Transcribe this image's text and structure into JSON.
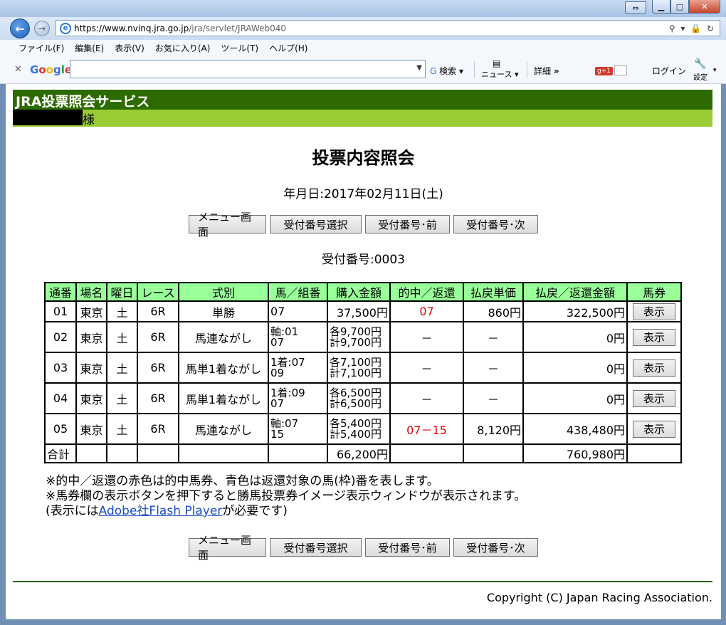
{
  "browser": {
    "url_host": "https://www.nvinq.jra.go.jp",
    "url_path": "/jra/servlet/JRAWeb040",
    "address_tools": "⚲ ▾ 🔒 ↻",
    "menu": [
      "ファイル(F)",
      "編集(E)",
      "表示(V)",
      "お気に入り(A)",
      "ツール(T)",
      "ヘルプ(H)"
    ],
    "google_toolbar": {
      "logo": "Google",
      "search_label": "検索",
      "news_label": "ニュース",
      "detail_label": "詳細",
      "gplus_label": "g+1",
      "login_label": "ログイン",
      "settings_label": "設定"
    }
  },
  "page": {
    "service_title": "JRA投票照会サービス",
    "user_suffix": "様",
    "heading": "投票内容照会",
    "date_label": "年月日:2017年02月11日(土)",
    "receipt_label": "受付番号:0003",
    "nav_buttons": [
      "メニュー画面",
      "受付番号選択",
      "受付番号･前",
      "受付番号･次"
    ],
    "table": {
      "headers": [
        "通番",
        "場名",
        "曜日",
        "レース",
        "式別",
        "馬／組番",
        "購入金額",
        "的中／返還",
        "払戻単価",
        "払戻／返還金額",
        "馬券"
      ],
      "rows": [
        {
          "no": "01",
          "place": "東京",
          "day": "土",
          "race": "6R",
          "type": "単勝",
          "horse1": "07",
          "horse2": "",
          "amt1": "37,500円",
          "amt2": "",
          "hit": "07",
          "unit": "860円",
          "payout": "322,500円",
          "btn": "表示"
        },
        {
          "no": "02",
          "place": "東京",
          "day": "土",
          "race": "6R",
          "type": "馬連ながし",
          "horse1": "軸:01",
          "horse2": "07",
          "amt1": "各9,700円",
          "amt2": "計9,700円",
          "hit": "－",
          "unit": "－",
          "payout": "0円",
          "btn": "表示"
        },
        {
          "no": "03",
          "place": "東京",
          "day": "土",
          "race": "6R",
          "type": "馬単1着ながし",
          "horse1": "1着:07",
          "horse2": "09",
          "amt1": "各7,100円",
          "amt2": "計7,100円",
          "hit": "－",
          "unit": "－",
          "payout": "0円",
          "btn": "表示"
        },
        {
          "no": "04",
          "place": "東京",
          "day": "土",
          "race": "6R",
          "type": "馬単1着ながし",
          "horse1": "1着:09",
          "horse2": "07",
          "amt1": "各6,500円",
          "amt2": "計6,500円",
          "hit": "－",
          "unit": "－",
          "payout": "0円",
          "btn": "表示"
        },
        {
          "no": "05",
          "place": "東京",
          "day": "土",
          "race": "6R",
          "type": "馬連ながし",
          "horse1": "軸:07",
          "horse2": "15",
          "amt1": "各5,400円",
          "amt2": "計5,400円",
          "hit": "07－15",
          "unit": "8,120円",
          "payout": "438,480円",
          "btn": "表示"
        }
      ],
      "total": {
        "label": "合計",
        "amount": "66,200円",
        "payout": "760,980円"
      }
    },
    "notes": {
      "line1": "※的中／返還の赤色は的中馬券、青色は返還対象の馬(枠)番を表します。",
      "line2": "※馬券欄の表示ボタンを押下すると勝馬投票券イメージ表示ウィンドウが表示されます。",
      "line3_prefix": "(表示には",
      "line3_link": "Adobe社Flash Player",
      "line3_suffix": "が必要です)"
    },
    "copyright": "Copyright (C) Japan Racing Association."
  },
  "colors": {
    "header_dark_green": "#2d6a00",
    "header_light_green": "#99cc33",
    "table_header_green": "#99ff99",
    "hit_red": "#e00000",
    "link_blue": "#1a4cc7"
  }
}
